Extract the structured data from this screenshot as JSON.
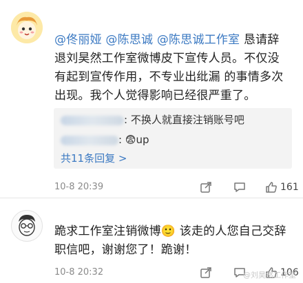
{
  "comments": [
    {
      "mentions": [
        "@佟丽娅",
        "@陈思诚",
        "@陈思诚工作室"
      ],
      "body_lines": [
        "恳请辞",
        "退刘昊然工作室微博皮下宣传人员。不仅没",
        "有起到宣传作用，不专业出纰漏 的事情多次",
        "出现。我个人觉得影响已经很严重了。"
      ],
      "replies": [
        {
          "text": ": 不换人就直接注销账号吧"
        },
        {
          "text": ": 😨up"
        }
      ],
      "more_replies": "共11条回复 >",
      "timestamp": "10-8 20:39",
      "likes": "161"
    },
    {
      "body_lines": [
        "跪求工作室注销微博🙂 该走的人您自己交辞",
        "职信吧，谢谢您了！跪谢！"
      ],
      "timestamp": "10-8 20:32",
      "likes": "106"
    }
  ],
  "icons": {
    "share": "share-icon",
    "comment": "comment-icon",
    "like": "thumbs-up-icon"
  },
  "watermark": "@刘昊然工作室"
}
